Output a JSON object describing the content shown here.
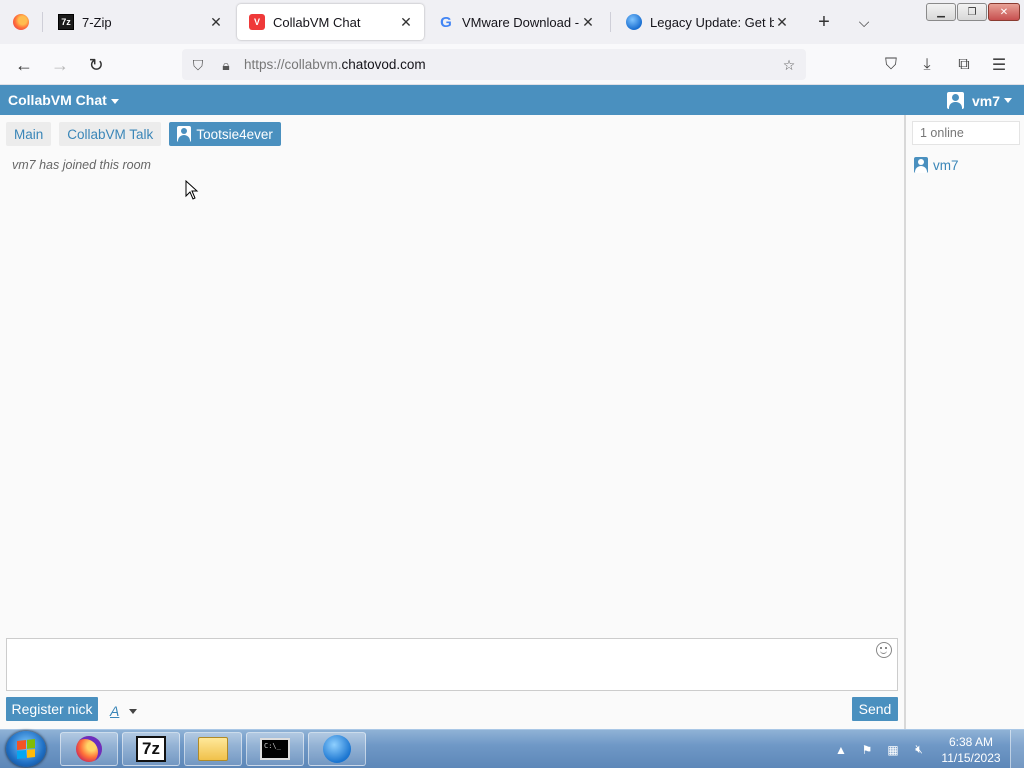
{
  "browser": {
    "tabs": [
      {
        "title": "7-Zip",
        "favicon": "7zip-icon",
        "active": false
      },
      {
        "title": "CollabVM Chat",
        "favicon": "vivaldi-icon",
        "active": true
      },
      {
        "title": "VMware Download - Goo",
        "favicon": "google-icon",
        "active": false
      },
      {
        "title": "Legacy Update: Get back",
        "favicon": "legacy-update-icon",
        "active": false
      }
    ],
    "url_prefix": "https://collabvm.",
    "url_domain": "chatovod.com",
    "new_tab_glyph": "+",
    "tab_close_glyph": "✕"
  },
  "chat": {
    "brand": "CollabVM Chat",
    "username": "vm7",
    "rooms": [
      {
        "label": "Main",
        "active": false
      },
      {
        "label": "CollabVM Talk",
        "active": false
      },
      {
        "label": "Tootsie4ever",
        "active": true
      }
    ],
    "messages": [
      {
        "text": "vm7 has joined this room",
        "type": "system"
      }
    ],
    "input": {
      "value": "",
      "placeholder": ""
    },
    "register_label": "Register nick",
    "font_label": "A",
    "send_label": "Send",
    "online_label": "1 online",
    "users": [
      "vm7"
    ],
    "accent_color": "#4a90bf"
  },
  "taskbar": {
    "apps": [
      "firefox-icon",
      "7zip-icon",
      "explorer-icon",
      "cmd-icon",
      "legacy-update-icon"
    ],
    "time": "6:38 AM",
    "date": "11/15/2023"
  }
}
